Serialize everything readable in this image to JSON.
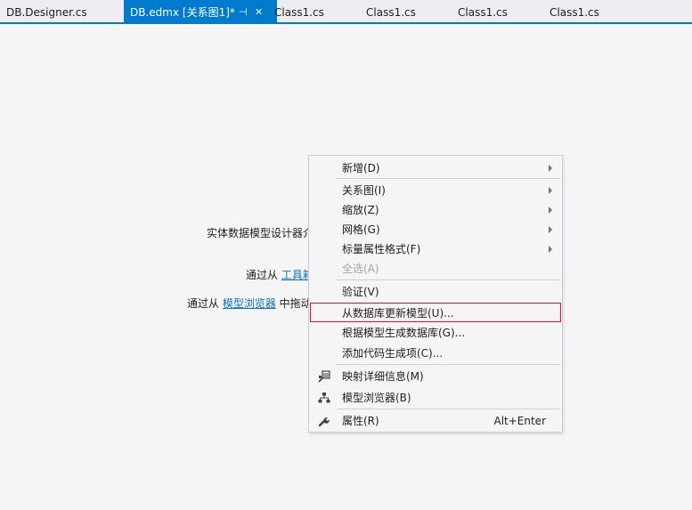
{
  "tabs": [
    {
      "label": "DB.Designer.cs"
    },
    {
      "label": "DB.edmx [关系图1]*",
      "pin": "⊣",
      "close": "✕"
    },
    {
      "label": "Class1.cs"
    },
    {
      "label": "Class1.cs"
    },
    {
      "label": "Class1.cs"
    },
    {
      "label": "Class1.cs"
    }
  ],
  "hints": {
    "line1": "实体数据模型设计器介",
    "line2_prefix": "通过从 ",
    "line2_link": "工具箱",
    "line3_prefix": "通过从 ",
    "line3_link": "模型浏览器",
    "line3_suffix": " 中拖动"
  },
  "context_menu": {
    "items": [
      {
        "label": "新增(D)",
        "submenu": true
      },
      {
        "label": "关系图(I)",
        "submenu": true
      },
      {
        "label": "缩放(Z)",
        "submenu": true
      },
      {
        "label": "网格(G)",
        "submenu": true
      },
      {
        "label": "标量属性格式(F)",
        "submenu": true
      },
      {
        "label": "全选(A)",
        "disabled": true
      },
      {
        "label": "验证(V)"
      },
      {
        "label": "从数据库更新模型(U)...",
        "highlighted": true
      },
      {
        "label": "根据模型生成数据库(G)..."
      },
      {
        "label": "添加代码生成项(C)..."
      },
      {
        "label": "映射详细信息(M)",
        "icon": "mapping-details-icon"
      },
      {
        "label": "模型浏览器(B)",
        "icon": "model-browser-icon"
      },
      {
        "label": "属性(R)",
        "icon": "wrench-icon",
        "shortcut": "Alt+Enter"
      }
    ]
  },
  "colors": {
    "accent": "#007acc",
    "highlight_border": "#e81123",
    "link": "#0e70c0",
    "background": "#f5f5f5"
  }
}
